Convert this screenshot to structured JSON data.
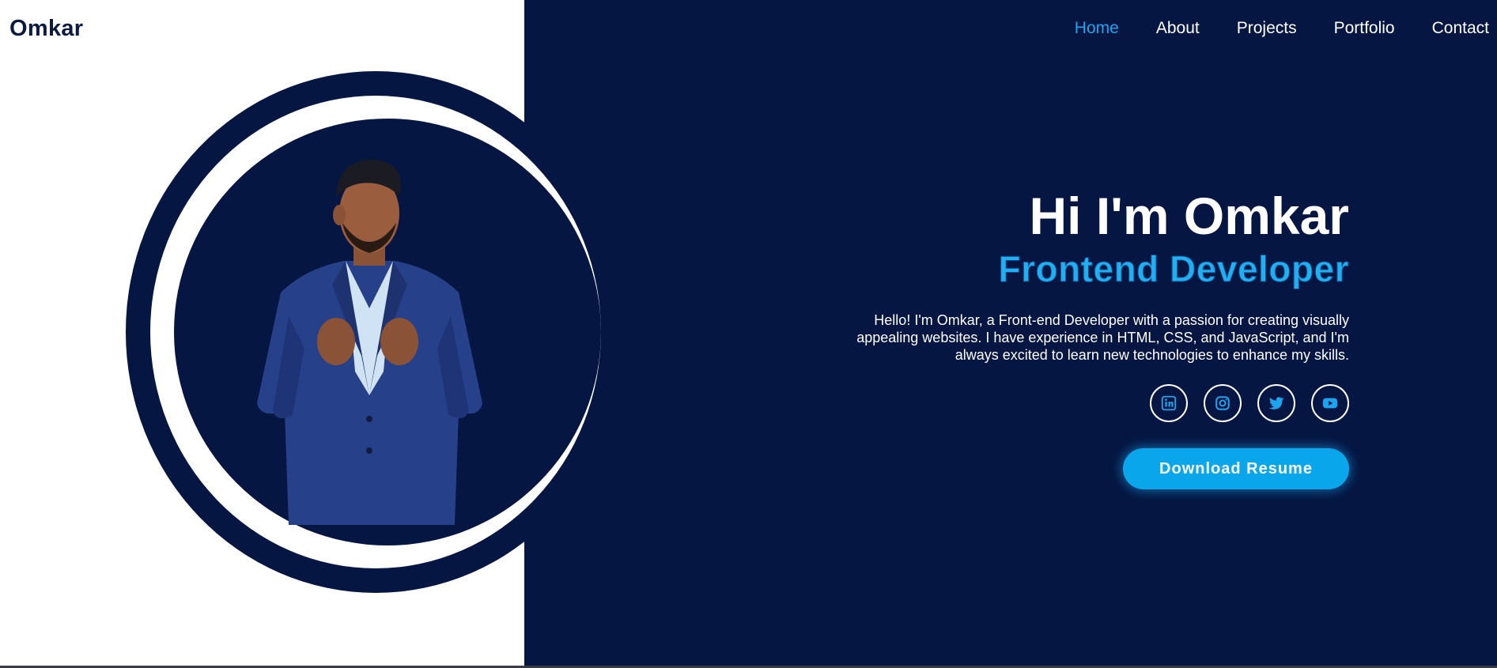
{
  "header": {
    "logo": "Omkar",
    "nav": [
      {
        "label": "Home",
        "active": true
      },
      {
        "label": "About",
        "active": false
      },
      {
        "label": "Projects",
        "active": false
      },
      {
        "label": "Portfolio",
        "active": false
      },
      {
        "label": "Contact",
        "active": false
      }
    ]
  },
  "hero": {
    "greeting": "Hi I'm Omkar",
    "role": "Frontend Developer",
    "intro": "Hello! I'm Omkar, a Front-end Developer with a passion for creating visually appealing websites. I have experience in HTML, CSS, and JavaScript, and I'm always excited to learn new technologies to enhance my skills.",
    "socials": [
      {
        "icon": "linkedin-icon"
      },
      {
        "icon": "instagram-icon"
      },
      {
        "icon": "twitter-icon"
      },
      {
        "icon": "youtube-icon"
      }
    ],
    "resume_button": "Download Resume"
  },
  "colors": {
    "navy": "#051642",
    "accent": "#1ea3ee",
    "button": "#0aa6ec"
  }
}
